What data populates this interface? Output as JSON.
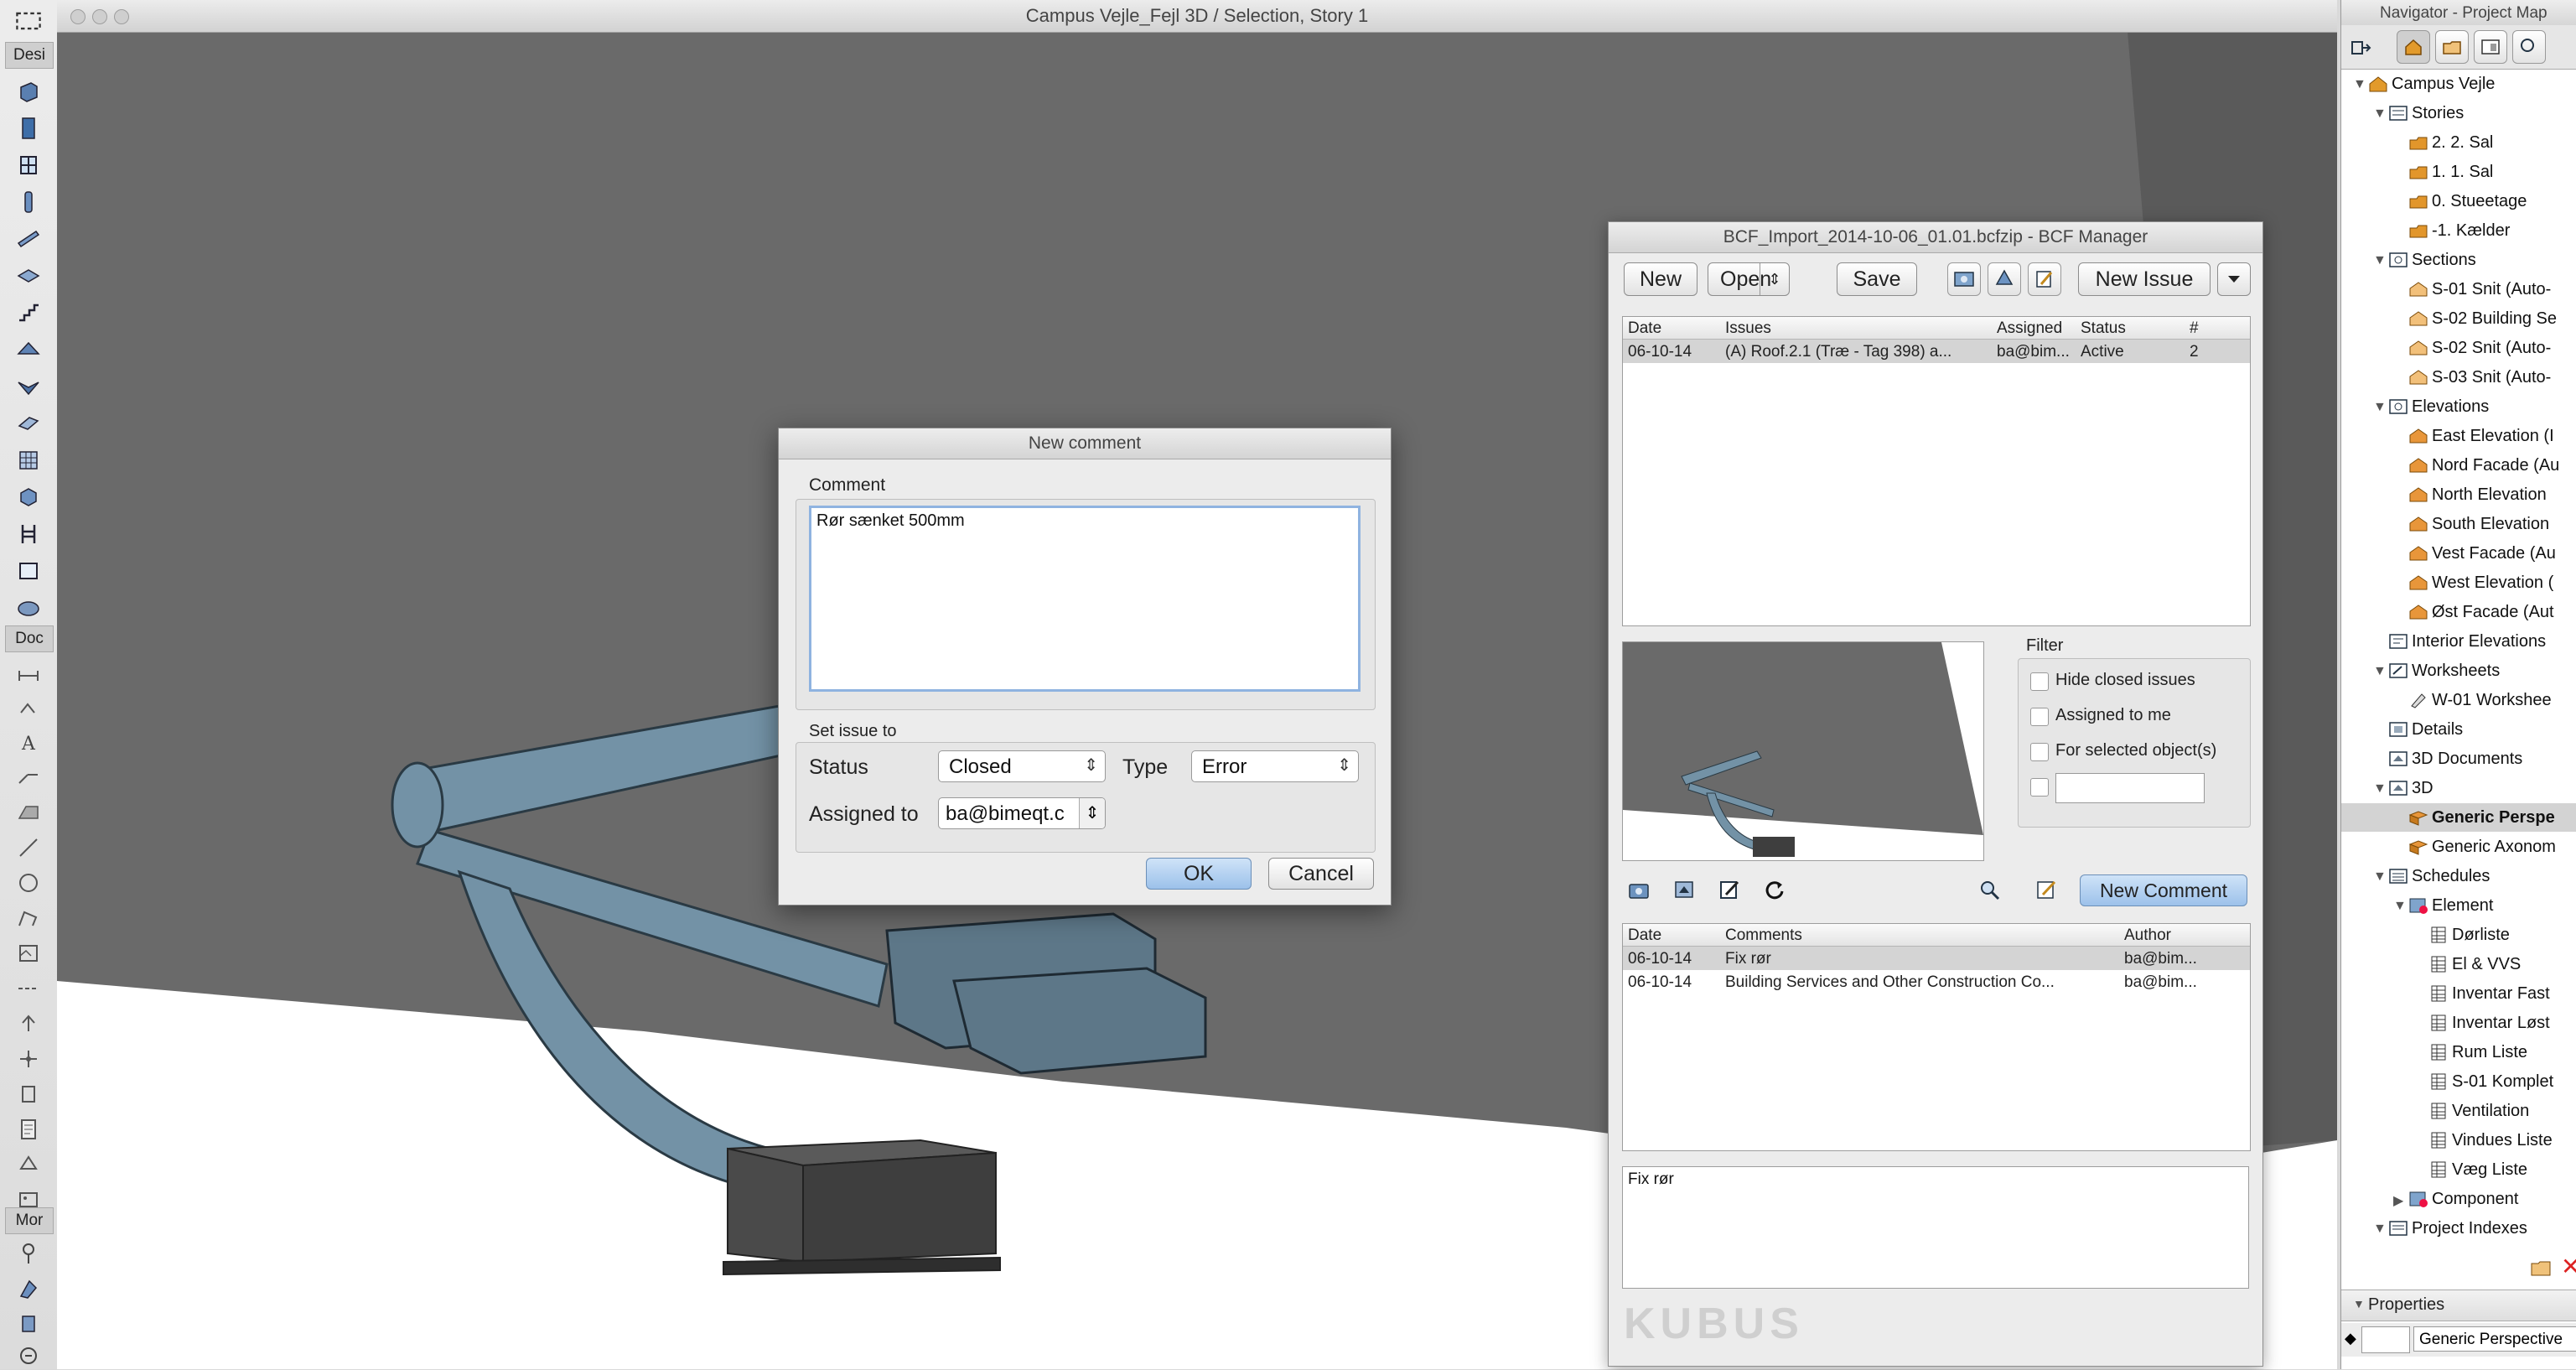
{
  "toolbox": {
    "design_label": "Desi",
    "doc_label": "Doc",
    "more_label": "Mor"
  },
  "viewport": {
    "title": "Campus Vejle_Fejl 3D / Selection, Story 1"
  },
  "comment_dialog": {
    "title": "New comment",
    "comment_label": "Comment",
    "comment_text": "Rør sænket 500mm",
    "set_issue_label": "Set issue to",
    "status_label": "Status",
    "status_value": "Closed",
    "type_label": "Type",
    "type_value": "Error",
    "assigned_label": "Assigned to",
    "assigned_value": "ba@bimeqt.c",
    "ok_label": "OK",
    "cancel_label": "Cancel"
  },
  "bcf_manager": {
    "title": "BCF_Import_2014-10-06_01.01.bcfzip - BCF Manager",
    "new_label": "New",
    "open_label": "Open",
    "save_label": "Save",
    "new_issue_label": "New Issue",
    "issues_columns": [
      "Date",
      "Issues",
      "Assigned",
      "Status",
      "#"
    ],
    "issues": [
      {
        "date": "06-10-14",
        "issue": "(A) Roof.2.1 (Træ - Tag 398) a...",
        "assigned": "ba@bim...",
        "status": "Active",
        "count": "2"
      }
    ],
    "filter_label": "Filter",
    "filter_hide_closed": "Hide closed issues",
    "filter_assigned_me": "Assigned to me",
    "filter_selected": "For selected object(s)",
    "new_comment_label": "New Comment",
    "comments_columns": [
      "Date",
      "Comments",
      "Author"
    ],
    "comments": [
      {
        "date": "06-10-14",
        "comment": "Fix rør",
        "author": "ba@bim..."
      },
      {
        "date": "06-10-14",
        "comment": "Building Services and Other Construction Co...",
        "author": "ba@bim..."
      }
    ],
    "comment_detail": "Fix rør",
    "watermark": "KUBUS"
  },
  "navigator": {
    "title": "Navigator - Project Map",
    "items": [
      {
        "label": "Campus Vejle"
      },
      {
        "label": "Stories"
      },
      {
        "label": "2. 2. Sal"
      },
      {
        "label": "1. 1. Sal"
      },
      {
        "label": "0. Stueetage"
      },
      {
        "label": "-1. Kælder"
      },
      {
        "label": "Sections"
      },
      {
        "label": "S-01 Snit (Auto-"
      },
      {
        "label": "S-02 Building Se"
      },
      {
        "label": "S-02 Snit (Auto-"
      },
      {
        "label": "S-03 Snit (Auto-"
      },
      {
        "label": "Elevations"
      },
      {
        "label": "East Elevation (I"
      },
      {
        "label": "Nord Facade (Au"
      },
      {
        "label": "North Elevation"
      },
      {
        "label": "South Elevation"
      },
      {
        "label": "Vest Facade (Au"
      },
      {
        "label": "West Elevation ("
      },
      {
        "label": "Øst Facade (Aut"
      },
      {
        "label": "Interior Elevations"
      },
      {
        "label": "Worksheets"
      },
      {
        "label": "W-01 Workshee"
      },
      {
        "label": "Details"
      },
      {
        "label": "3D Documents"
      },
      {
        "label": "3D"
      },
      {
        "label": "Generic Perspe"
      },
      {
        "label": "Generic Axonom"
      },
      {
        "label": "Schedules"
      },
      {
        "label": "Element"
      },
      {
        "label": "Dørliste"
      },
      {
        "label": "El & VVS"
      },
      {
        "label": "Inventar Fast"
      },
      {
        "label": "Inventar Løst"
      },
      {
        "label": "Rum Liste"
      },
      {
        "label": "S-01 Komplet"
      },
      {
        "label": "Ventilation"
      },
      {
        "label": "Vindues Liste"
      },
      {
        "label": "Væg Liste"
      },
      {
        "label": "Component"
      },
      {
        "label": "Project Indexes"
      }
    ],
    "properties_label": "Properties",
    "properties_value": "Generic Perspective"
  }
}
